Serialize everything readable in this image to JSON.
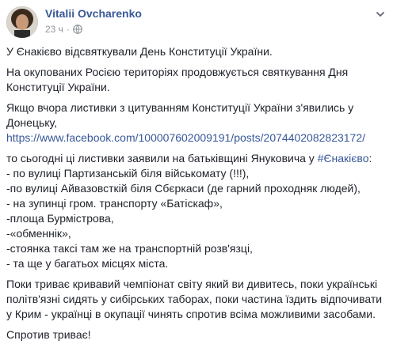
{
  "post": {
    "author_name": "Vitalii Ovcharenko",
    "timestamp": "23 ч",
    "separator": "·",
    "audience_icon": "globe-icon",
    "menu_icon": "chevron-down-icon",
    "paragraphs": {
      "p1": "У Єнакієво відсвяткували День Конституції України.",
      "p2_l1": "На окупованих Росією територіях продовжується святкування Дня",
      "p2_l2": "Конституції України.",
      "p3_l1": "Якщо вчора листивки з цитуванням Конституції України з'явились у",
      "p3_l2": "Донецьку,",
      "p3_link": "https://www.facebook.com/100007602009191/posts/2074402082823172/",
      "p4_l1_text": "то сьогодні ці листивки заявили на батьківщині Януковича у ",
      "p4_l1_hashtag": "#Єнакієво",
      "p4_l1_end": ":",
      "p4_l2": "- по вулиці Партизанській біля військомату (!!!),",
      "p4_l3": "-по вулиці Айвазовсткій біля Сбєркаси (де гарний проходняк людей),",
      "p4_l4": "- на зупинці гром. транспорту «Батіскаф»,",
      "p4_l5": "-площа Бурмістрова,",
      "p4_l6": "-«обменнік»,",
      "p4_l7": "-стоянка таксі там же на транспортній розв'язці,",
      "p4_l8": "- та ще у багатьох місцях міста.",
      "p5_l1": "Поки триває кривавий чемпіонат світу який ви дивитесь, поки українські",
      "p5_l2": "політв'язні сидять у сибірських таборах, поки частина їздить відпочивати",
      "p5_l3": "у Крим - українці в окупації чинять спротив всіма можливими засобами.",
      "p6": "Спротив триває!"
    },
    "colors": {
      "link": "#385898",
      "text": "#1d2129",
      "meta": "#90949c"
    }
  }
}
